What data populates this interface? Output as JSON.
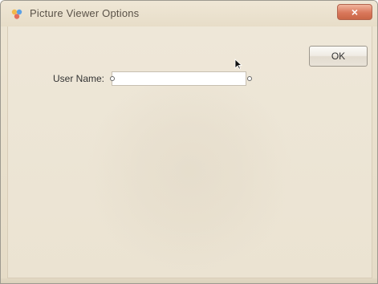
{
  "window": {
    "title": "Picture Viewer Options",
    "close_label": "×"
  },
  "dialog": {
    "ok_label": "OK",
    "username_label": "User Name:",
    "username_value": "",
    "username_placeholder": ""
  },
  "icons": {
    "app": "picture-viewer-icon",
    "close": "close-icon",
    "cursor": "mouse-pointer-icon",
    "handle": "resize-handle-icon"
  },
  "colors": {
    "title_text": "#5a5248",
    "close_button": "#d9775b",
    "window_background": "#ede5d3"
  }
}
